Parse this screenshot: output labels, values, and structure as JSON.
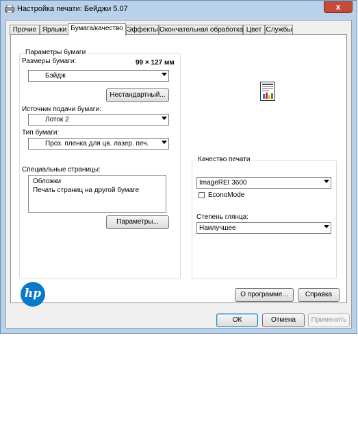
{
  "window": {
    "title": "Настройка печати: Бейджи 5.07",
    "close_symbol": "x"
  },
  "tabs": [
    {
      "label": "Прочие"
    },
    {
      "label": "Ярлыки"
    },
    {
      "label": "Бумага/качество"
    },
    {
      "label": "Эффекты"
    },
    {
      "label": "Окончательная обработка"
    },
    {
      "label": "Цвет"
    },
    {
      "label": "Службы"
    }
  ],
  "active_tab": "Бумага/качество",
  "paper": {
    "group_label": "Параметры бумаги",
    "size_label": "Размеры бумаги:",
    "size_dimensions": "99 × 127 мм",
    "size_value": "Бэйдж",
    "custom_button": "Нестандартный...",
    "source_label": "Источник подачи бумаги:",
    "source_value": "Лоток 2",
    "type_label": "Тип бумаги:",
    "type_value": "Проз. пленка для цв. лазер. печ.",
    "special_label": "Специальные страницы:",
    "special_items": [
      "Обложки",
      "Печать страниц на другой бумаге"
    ],
    "settings_button": "Параметры..."
  },
  "quality": {
    "group_label": "Качество печати",
    "quality_value": "ImageREt 3600",
    "economode_label": "EconoMode",
    "economode_checked": false,
    "gloss_label": "Степень глянца:",
    "gloss_value": "Наилучшее"
  },
  "hp_logo_text": "hp",
  "buttons": {
    "about": "О программе...",
    "help": "Справка",
    "ok": "ОК",
    "cancel": "Отмена",
    "apply": "Применить"
  }
}
